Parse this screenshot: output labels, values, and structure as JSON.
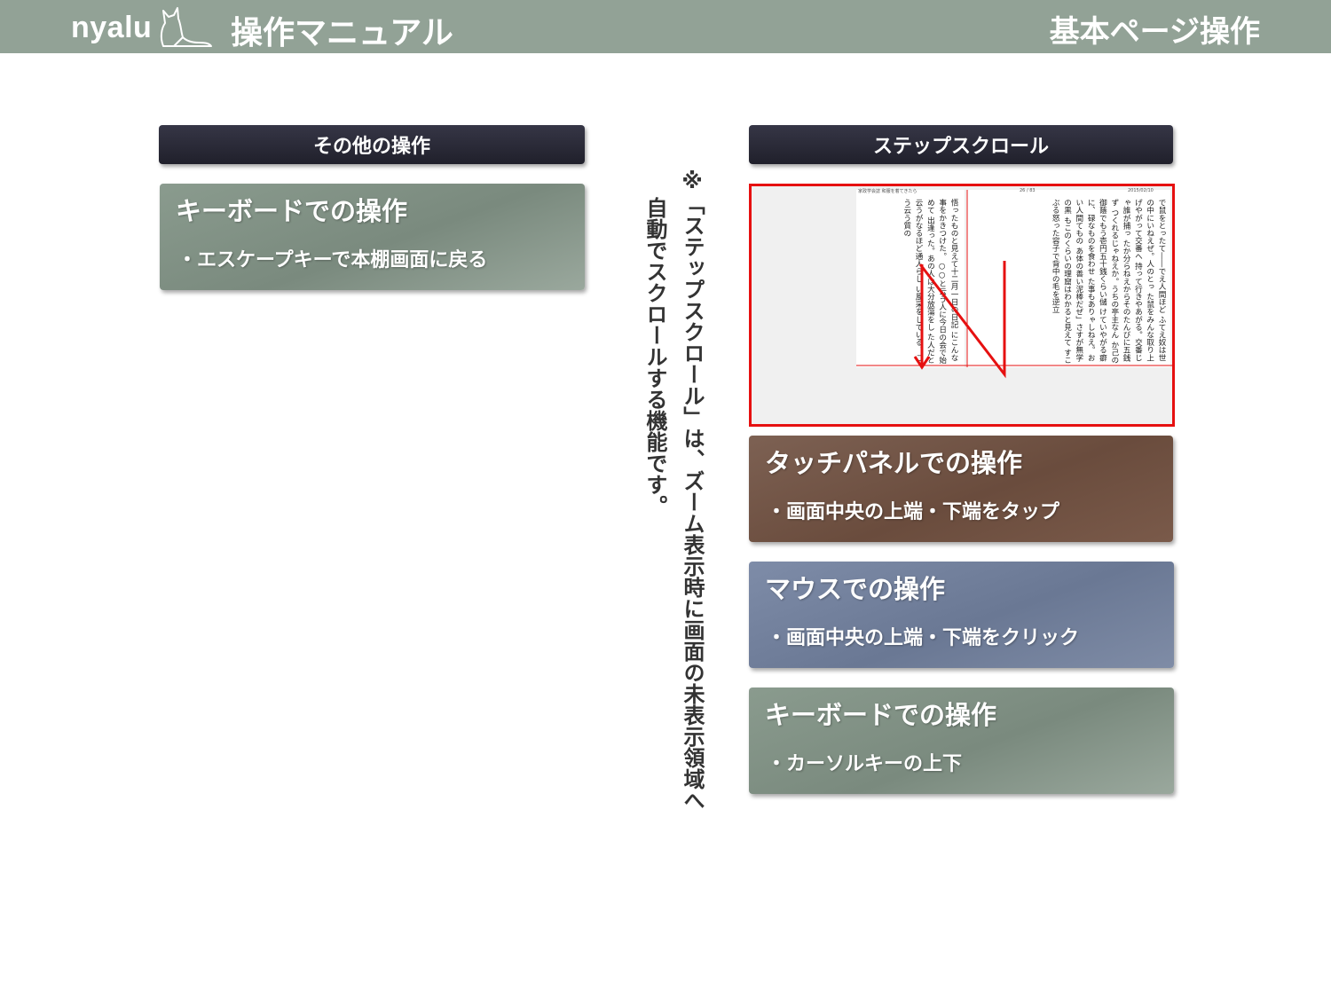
{
  "header": {
    "brand": "nyalu",
    "manual_title": "操作マニュアル",
    "page_title": "基本ページ操作"
  },
  "left": {
    "section_title": "その他の操作",
    "card": {
      "title": "キーボードでの操作",
      "desc": "・エスケープキーで本棚画面に戻る"
    }
  },
  "note": {
    "line1": "※「ステップスクロール」は、ズーム表示時に画面の未表示領域へ",
    "line2": "自動でスクロールする機能です。"
  },
  "right": {
    "section_title": "ステップスクロール",
    "preview": {
      "book_title": "家政学会誌 和服を着てきたら",
      "page_info": "26 / 83",
      "date": "2015/02/10",
      "text_right": "で鼠をとったて――でえ人間ほど ふてえ奴は世の中にいねえぜ。人のとっ た鼠をみんな取り上げやがって交番へ 持って行きやあがる。交番じゃ誰が捕っ たか分らねえからそのたんびに五銭ず つくれるじゃねえか。うちの亭主なん か己の御蔭でもう壱円五十銭くらい儲 けていやがる癖に、碌なものを食わせ た事もありゃしねえ。おい人間てもの あ体の善い泥棒だぜ」さすが無学の黒 もこのくらいの理窟はわかると見えて すこぶる怒った容子で背中の毛を逆立",
      "text_left": "悟ったものと見えて十二月一日の日記 にこんな事をかきつけた。 ○○と云う人に今日の会で始めて 出逢った。あの人は大分放蕩をし た人だと云うがなるほど通人らし い風采をしている。こう云う質の"
    },
    "cards": [
      {
        "title": "タッチパネルでの操作",
        "desc": "・画面中央の上端・下端をタップ"
      },
      {
        "title": "マウスでの操作",
        "desc": "・画面中央の上端・下端をクリック"
      },
      {
        "title": "キーボードでの操作",
        "desc": "・カーソルキーの上下"
      }
    ]
  },
  "colors": {
    "header_bg": "#92a296",
    "section_header_bg": "#262633",
    "card_green": "#7f9083",
    "card_brown": "#70523f",
    "card_blue": "#73819d",
    "highlight_red": "#e61010"
  }
}
